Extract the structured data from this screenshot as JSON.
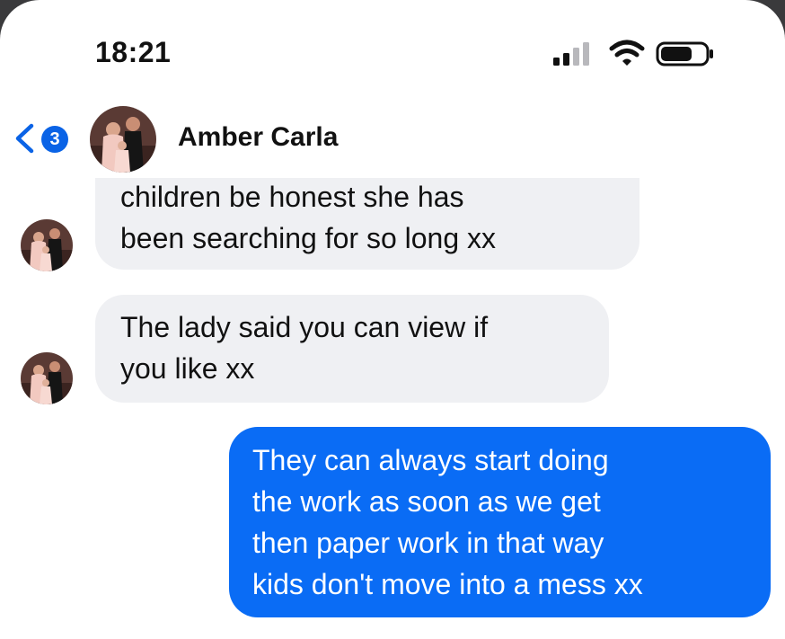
{
  "status_bar": {
    "time": "18:21",
    "icons": [
      "cellular-signal-icon",
      "wifi-icon",
      "battery-icon"
    ]
  },
  "header": {
    "unread_count": "3",
    "contact_name": "Amber Carla",
    "icons": [
      "back-chevron-icon"
    ]
  },
  "messages": [
    {
      "direction": "incoming",
      "lines": [
        "children be honest she has",
        "been searching for so long xx"
      ]
    },
    {
      "direction": "incoming",
      "lines": [
        "The lady said you can view if",
        "you like xx"
      ]
    },
    {
      "direction": "outgoing",
      "lines": [
        "They can always start doing",
        "the work as soon as we get",
        "then paper work in that way",
        "kids don't move into a mess xx"
      ]
    }
  ],
  "colors": {
    "outgoing_bubble": "#0a6cf5",
    "incoming_bubble": "#eff0f3",
    "accent": "#0a63e6"
  }
}
